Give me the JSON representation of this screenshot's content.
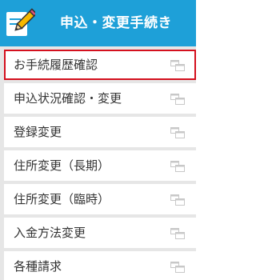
{
  "header": {
    "title": "申込・変更手続き",
    "icon": "pencil-note-icon"
  },
  "colors": {
    "header_bg": "#1ea0d8",
    "active_border": "#d4101e",
    "panel_bg": "#e6e6e6",
    "item_bg": "#ffffff",
    "text": "#333333"
  },
  "menu": {
    "items": [
      {
        "label": "お手続履歴確認",
        "icon": "new-window-icon",
        "active": true
      },
      {
        "label": "申込状況確認・変更",
        "icon": "new-window-icon"
      },
      {
        "label": "登録変更",
        "icon": "new-window-icon"
      },
      {
        "label": "住所変更（長期）",
        "icon": "new-window-icon"
      },
      {
        "label": "住所変更（臨時）",
        "icon": "new-window-icon"
      },
      {
        "label": "入金方法変更",
        "icon": "new-window-icon"
      },
      {
        "label": "各種請求",
        "icon": "new-window-icon"
      }
    ]
  }
}
